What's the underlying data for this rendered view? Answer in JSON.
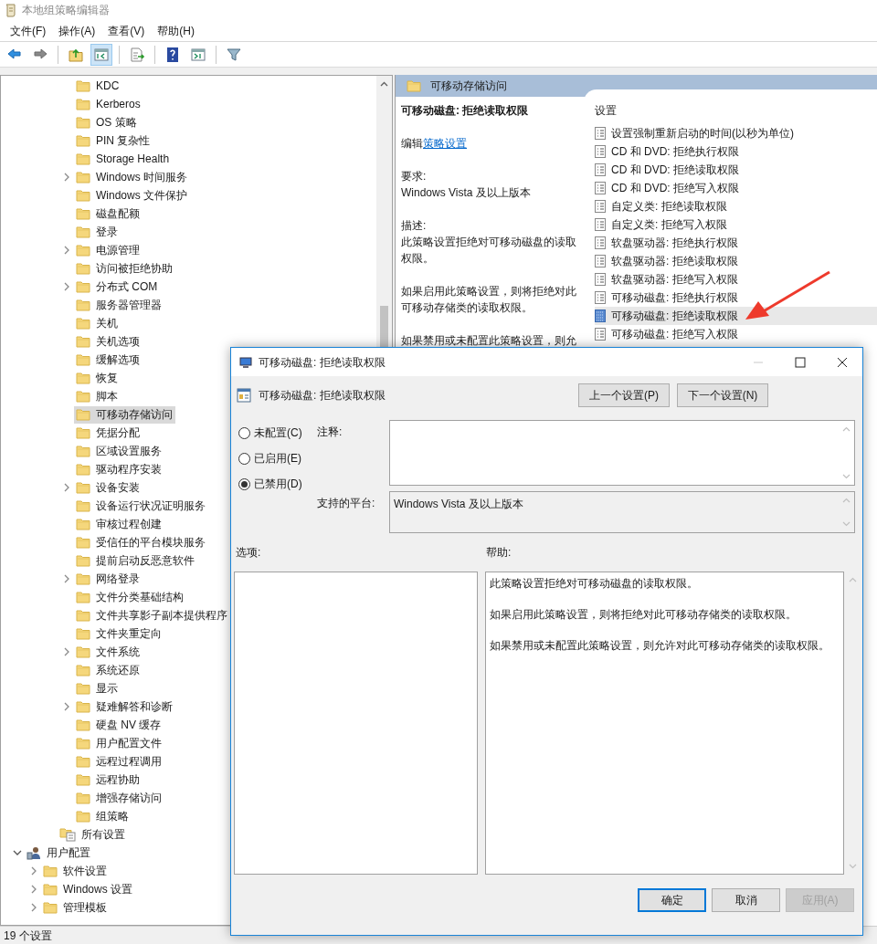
{
  "window": {
    "title": "本地组策略编辑器"
  },
  "menu": [
    "文件(F)",
    "操作(A)",
    "查看(V)",
    "帮助(H)"
  ],
  "toolbar": [
    [
      {
        "kind": "back",
        "pressed": false
      },
      {
        "kind": "forward",
        "pressed": false
      }
    ],
    [
      {
        "kind": "up",
        "pressed": false
      },
      {
        "kind": "tree",
        "pressed": true
      }
    ],
    [
      {
        "kind": "export",
        "pressed": false
      }
    ],
    [
      {
        "kind": "help",
        "pressed": false
      },
      {
        "kind": "view",
        "pressed": false
      }
    ],
    [
      {
        "kind": "filter",
        "pressed": false
      }
    ]
  ],
  "tree": [
    {
      "children": [
        {
          "children": [
            {
              "children": [
                {
                  "label": "KDC",
                  "kind": "folder",
                  "has_children": false,
                  "selected": false
                },
                {
                  "label": "Kerberos",
                  "kind": "folder",
                  "has_children": false,
                  "selected": false
                },
                {
                  "label": "OS 策略",
                  "kind": "folder",
                  "has_children": false,
                  "selected": false
                },
                {
                  "label": "PIN 复杂性",
                  "kind": "folder",
                  "has_children": false,
                  "selected": false
                },
                {
                  "label": "Storage Health",
                  "kind": "folder",
                  "has_children": false,
                  "selected": false
                },
                {
                  "label": "Windows 时间服务",
                  "kind": "folder",
                  "has_children": true,
                  "selected": false
                },
                {
                  "label": "Windows 文件保护",
                  "kind": "folder",
                  "has_children": false,
                  "selected": false
                },
                {
                  "label": "磁盘配额",
                  "kind": "folder",
                  "has_children": false,
                  "selected": false
                },
                {
                  "label": "登录",
                  "kind": "folder",
                  "has_children": false,
                  "selected": false
                },
                {
                  "label": "电源管理",
                  "kind": "folder",
                  "has_children": true,
                  "selected": false
                },
                {
                  "label": "访问被拒绝协助",
                  "kind": "folder",
                  "has_children": false,
                  "selected": false
                },
                {
                  "label": "分布式 COM",
                  "kind": "folder",
                  "has_children": true,
                  "selected": false
                },
                {
                  "label": "服务器管理器",
                  "kind": "folder",
                  "has_children": false,
                  "selected": false
                },
                {
                  "label": "关机",
                  "kind": "folder",
                  "has_children": false,
                  "selected": false
                },
                {
                  "label": "关机选项",
                  "kind": "folder",
                  "has_children": false,
                  "selected": false
                },
                {
                  "label": "缓解选项",
                  "kind": "folder",
                  "has_children": false,
                  "selected": false
                },
                {
                  "label": "恢复",
                  "kind": "folder",
                  "has_children": false,
                  "selected": false
                },
                {
                  "label": "脚本",
                  "kind": "folder",
                  "has_children": false,
                  "selected": false
                },
                {
                  "label": "可移动存储访问",
                  "kind": "folder",
                  "has_children": false,
                  "selected": true
                },
                {
                  "label": "凭据分配",
                  "kind": "folder",
                  "has_children": false,
                  "selected": false
                },
                {
                  "label": "区域设置服务",
                  "kind": "folder",
                  "has_children": false,
                  "selected": false
                },
                {
                  "label": "驱动程序安装",
                  "kind": "folder",
                  "has_children": false,
                  "selected": false
                },
                {
                  "label": "设备安装",
                  "kind": "folder",
                  "has_children": true,
                  "selected": false
                },
                {
                  "label": "设备运行状况证明服务",
                  "kind": "folder",
                  "has_children": false,
                  "selected": false
                },
                {
                  "label": "审核过程创建",
                  "kind": "folder",
                  "has_children": false,
                  "selected": false
                },
                {
                  "label": "受信任的平台模块服务",
                  "kind": "folder",
                  "has_children": false,
                  "selected": false
                },
                {
                  "label": "提前启动反恶意软件",
                  "kind": "folder",
                  "has_children": false,
                  "selected": false
                },
                {
                  "label": "网络登录",
                  "kind": "folder",
                  "has_children": true,
                  "selected": false
                },
                {
                  "label": "文件分类基础结构",
                  "kind": "folder",
                  "has_children": false,
                  "selected": false
                },
                {
                  "label": "文件共享影子副本提供程序",
                  "kind": "folder",
                  "has_children": false,
                  "selected": false
                },
                {
                  "label": "文件夹重定向",
                  "kind": "folder",
                  "has_children": false,
                  "selected": false
                },
                {
                  "label": "文件系统",
                  "kind": "folder",
                  "has_children": true,
                  "selected": false
                },
                {
                  "label": "系统还原",
                  "kind": "folder",
                  "has_children": false,
                  "selected": false
                },
                {
                  "label": "显示",
                  "kind": "folder",
                  "has_children": false,
                  "selected": false
                },
                {
                  "label": "疑难解答和诊断",
                  "kind": "folder",
                  "has_children": true,
                  "selected": false
                },
                {
                  "label": "硬盘 NV 缓存",
                  "kind": "folder",
                  "has_children": false,
                  "selected": false
                },
                {
                  "label": "用户配置文件",
                  "kind": "folder",
                  "has_children": false,
                  "selected": false
                },
                {
                  "label": "远程过程调用",
                  "kind": "folder",
                  "has_children": false,
                  "selected": false
                },
                {
                  "label": "远程协助",
                  "kind": "folder",
                  "has_children": false,
                  "selected": false
                },
                {
                  "label": "增强存储访问",
                  "kind": "folder",
                  "has_children": false,
                  "selected": false
                },
                {
                  "label": "组策略",
                  "kind": "folder",
                  "has_children": false,
                  "selected": false
                }
              ]
            },
            {
              "label": "所有设置",
              "kind": "settings",
              "has_children": false,
              "selected": false
            }
          ]
        }
      ]
    },
    {
      "label": "用户配置",
      "kind": "user",
      "has_children": true,
      "expanded": true,
      "selected": false,
      "children": [
        {
          "label": "软件设置",
          "kind": "folder",
          "has_children": true,
          "selected": false
        },
        {
          "label": "Windows 设置",
          "kind": "folder",
          "has_children": true,
          "selected": false
        },
        {
          "label": "管理模板",
          "kind": "folder",
          "has_children": true,
          "selected": false
        }
      ]
    }
  ],
  "details": {
    "header": "可移动存储访问",
    "title": "可移动磁盘: 拒绝读取权限",
    "edit_prefix": "编辑",
    "edit_link": "策略设置",
    "requirement_label": "要求:",
    "requirement": "Windows Vista 及以上版本",
    "description_label": "描述:",
    "paragraphs": [
      "此策略设置拒绝对可移动磁盘的读取权限。",
      "如果启用此策略设置，则将拒绝对此可移动存储类的读取权限。",
      "如果禁用或未配置此策略设置，则允"
    ]
  },
  "settings": {
    "column": "设置",
    "items": [
      {
        "label": "设置强制重新启动的时间(以秒为单位)",
        "selected": false
      },
      {
        "label": "CD 和 DVD: 拒绝执行权限",
        "selected": false
      },
      {
        "label": "CD 和 DVD: 拒绝读取权限",
        "selected": false
      },
      {
        "label": "CD 和 DVD: 拒绝写入权限",
        "selected": false
      },
      {
        "label": "自定义类: 拒绝读取权限",
        "selected": false
      },
      {
        "label": "自定义类: 拒绝写入权限",
        "selected": false
      },
      {
        "label": "软盘驱动器: 拒绝执行权限",
        "selected": false
      },
      {
        "label": "软盘驱动器: 拒绝读取权限",
        "selected": false
      },
      {
        "label": "软盘驱动器: 拒绝写入权限",
        "selected": false
      },
      {
        "label": "可移动磁盘: 拒绝执行权限",
        "selected": false
      },
      {
        "label": "可移动磁盘: 拒绝读取权限",
        "selected": true
      },
      {
        "label": "可移动磁盘: 拒绝写入权限",
        "selected": false
      }
    ]
  },
  "dialog": {
    "title": "可移动磁盘: 拒绝读取权限",
    "setting_name": "可移动磁盘: 拒绝读取权限",
    "nav_buttons": [
      "上一个设置(P)",
      "下一个设置(N)"
    ],
    "states": [
      {
        "label": "未配置(C)",
        "selected": false
      },
      {
        "label": "已启用(E)",
        "selected": false
      },
      {
        "label": "已禁用(D)",
        "selected": true
      }
    ],
    "comment_label": "注释:",
    "platform_label": "支持的平台:",
    "platform": "Windows Vista 及以上版本",
    "options_label": "选项:",
    "help_label": "帮助:",
    "help": [
      "此策略设置拒绝对可移动磁盘的读取权限。",
      "如果启用此策略设置，则将拒绝对此可移动存储类的读取权限。",
      "如果禁用或未配置此策略设置，则允许对此可移动存储类的读取权限。"
    ],
    "buttons": [
      {
        "label": "确定",
        "kind": "default",
        "disabled": false
      },
      {
        "label": "取消",
        "kind": "normal",
        "disabled": false
      },
      {
        "label": "应用(A)",
        "kind": "normal",
        "disabled": true
      }
    ]
  },
  "status_bar": "19 个设置"
}
